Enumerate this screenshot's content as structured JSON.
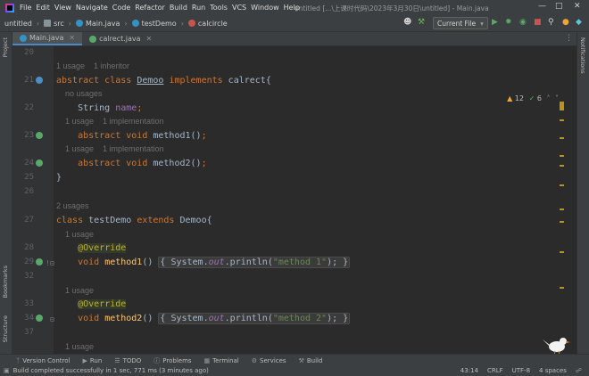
{
  "menubar": {
    "items": [
      "File",
      "Edit",
      "View",
      "Navigate",
      "Code",
      "Refactor",
      "Build",
      "Run",
      "Tools",
      "VCS",
      "Window",
      "Help"
    ],
    "window_title": "untitled [...\\上课时代码\\2023年3月30日\\untitled] - Main.java"
  },
  "navbar": {
    "breadcrumbs": [
      "untitled",
      "src",
      "Main.java",
      "testDemo",
      "calcircle"
    ],
    "run_config": "Current File"
  },
  "tabs": [
    {
      "label": "Main.java",
      "active": true
    },
    {
      "label": "calrect.java",
      "active": false
    }
  ],
  "side_panels": {
    "left_top": "Project",
    "left_bottom_1": "Bookmarks",
    "left_bottom_2": "Structure",
    "right": "Notifications"
  },
  "inspections": {
    "warnings": "12",
    "ok": "6"
  },
  "editor": {
    "lines": [
      {
        "ln": "20",
        "text": ""
      },
      {
        "ln": "",
        "hint": "1 usage    1 inheritor"
      },
      {
        "ln": "21",
        "code": "abstract class Demoo implements calrect{"
      },
      {
        "ln": "",
        "hint": "    no usages"
      },
      {
        "ln": "22",
        "code": "    String name;"
      },
      {
        "ln": "",
        "hint": "    1 usage    1 implementation"
      },
      {
        "ln": "23",
        "code": "    abstract void method1();"
      },
      {
        "ln": "",
        "hint": "    1 usage    1 implementation"
      },
      {
        "ln": "24",
        "code": "    abstract void method2();"
      },
      {
        "ln": "25",
        "code": "}"
      },
      {
        "ln": "26",
        "text": ""
      },
      {
        "ln": "",
        "hint": "2 usages"
      },
      {
        "ln": "27",
        "code": "class testDemo extends Demoo{"
      },
      {
        "ln": "",
        "hint": "    1 usage"
      },
      {
        "ln": "28",
        "code": "    @Override"
      },
      {
        "ln": "29",
        "code": "    void method1() { System.out.println(\"method 1\"); }"
      },
      {
        "ln": "32",
        "text": ""
      },
      {
        "ln": "",
        "hint": "    1 usage"
      },
      {
        "ln": "33",
        "code": "    @Override"
      },
      {
        "ln": "34",
        "code": "    void method2() { System.out.println(\"method 2\"); }"
      },
      {
        "ln": "37",
        "text": ""
      },
      {
        "ln": "",
        "hint": "    1 usage"
      }
    ]
  },
  "tool_windows": [
    "Version Control",
    "Run",
    "TODO",
    "Problems",
    "Terminal",
    "Services",
    "Build"
  ],
  "status": {
    "message": "Build completed successfully in 1 sec, 771 ms (3 minutes ago)",
    "position": "43:14",
    "line_sep": "CRLF",
    "encoding": "UTF-8",
    "indent": "4 spaces"
  },
  "colors": {
    "keyword": "#cc7832",
    "annotation": "#bbb529",
    "method": "#ffc66d",
    "string": "#6a8759",
    "background": "#2b2b2b"
  }
}
